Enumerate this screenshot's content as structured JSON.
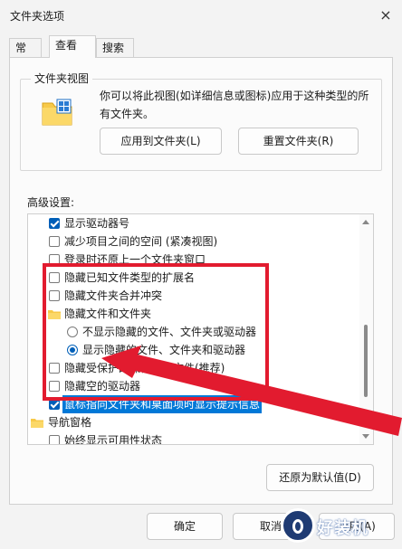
{
  "window": {
    "title": "文件夹选项",
    "close_glyph": "×"
  },
  "tabs": [
    {
      "label": "常规",
      "active": false
    },
    {
      "label": "查看",
      "active": true
    },
    {
      "label": "搜索",
      "active": false
    }
  ],
  "folder_views": {
    "label": "文件夹视图",
    "description": "你可以将此视图(如详细信息或图标)应用于这种类型的所有文件夹。",
    "apply_button": "应用到文件夹(L)",
    "reset_button": "重置文件夹(R)"
  },
  "advanced": {
    "label": "高级设置:",
    "items": [
      {
        "type": "checkbox",
        "checked": true,
        "label": "显示驱动器号"
      },
      {
        "type": "checkbox",
        "checked": false,
        "label": "减少项目之间的空间 (紧凑视图)"
      },
      {
        "type": "checkbox",
        "checked": false,
        "label": "登录时还原上一个文件夹窗口"
      },
      {
        "type": "checkbox",
        "checked": false,
        "label": "隐藏已知文件类型的扩展名"
      },
      {
        "type": "checkbox",
        "checked": false,
        "label": "隐藏文件夹合并冲突"
      },
      {
        "type": "folder",
        "label": "隐藏文件和文件夹"
      },
      {
        "type": "radio",
        "checked": false,
        "label": "不显示隐藏的文件、文件夹或驱动器"
      },
      {
        "type": "radio",
        "checked": true,
        "label": "显示隐藏的文件、文件夹和驱动器"
      },
      {
        "type": "checkbox",
        "checked": false,
        "label": "隐藏受保护的操作系统文件(推荐)"
      },
      {
        "type": "checkbox",
        "checked": false,
        "label": "隐藏空的驱动器"
      },
      {
        "type": "checkbox",
        "checked": true,
        "label": "鼠标指向文件夹和桌面项时显示提示信息",
        "highlighted": true
      },
      {
        "type": "folder",
        "label": "导航窗格"
      },
      {
        "type": "checkbox",
        "checked": false,
        "label": "始终显示可用性状态"
      }
    ]
  },
  "restore_defaults_button": "还原为默认值(D)",
  "footer": {
    "ok": "确定",
    "cancel": "取消",
    "apply": "应用(A)"
  },
  "watermark": {
    "text": "好装机"
  },
  "colors": {
    "annotation": "#e21b2f",
    "accent": "#005fb8",
    "selection": "#0078d7"
  }
}
